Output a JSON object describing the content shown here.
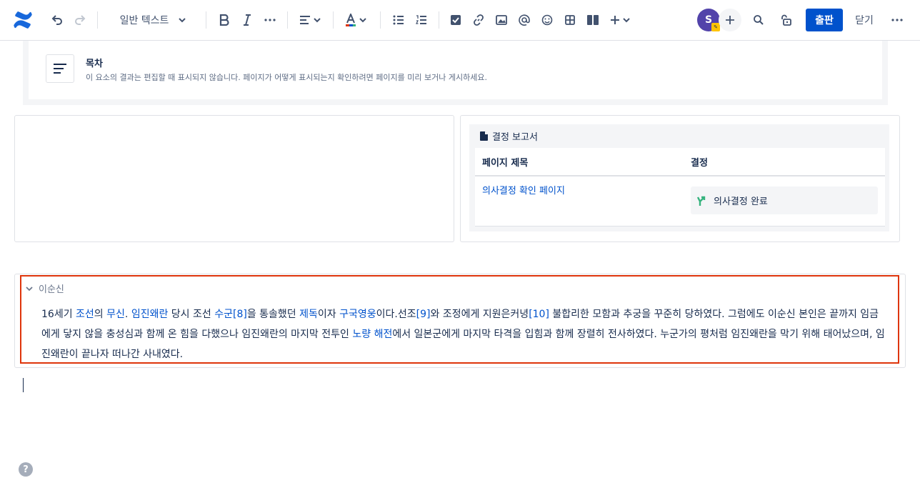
{
  "toolbar": {
    "text_style": "일반 텍스트",
    "avatar_initial": "S",
    "publish_label": "출판",
    "close_label": "닫기"
  },
  "toc": {
    "title": "목차",
    "description": "이 요소의 결과는 편집할 때 표시되지 않습니다. 페이지가 어떻게 표시되는지 확인하려면 페이지를 미리 보거나 게시하세요."
  },
  "decision_report": {
    "title": "결정 보고서",
    "col_page_title": "페이지 제목",
    "col_decision": "결정",
    "row_link": "의사결정 확인 페이지",
    "row_status": "의사결정 완료"
  },
  "expand": {
    "title": "이순신",
    "segments": [
      {
        "t": "16세기 "
      },
      {
        "t": "조선",
        "link": true
      },
      {
        "t": "의 "
      },
      {
        "t": "무신",
        "link": true
      },
      {
        "t": ". "
      },
      {
        "t": "임진왜란",
        "link": true
      },
      {
        "t": " 당시 조선 "
      },
      {
        "t": "수군",
        "link": true
      },
      {
        "t": "[8]",
        "link": true
      },
      {
        "t": "을 통솔했던 "
      },
      {
        "t": "제독",
        "link": true
      },
      {
        "t": "이자 "
      },
      {
        "t": "구국영웅",
        "link": true
      },
      {
        "t": "이다.선조"
      },
      {
        "t": "[9]",
        "link": true
      },
      {
        "t": "와 조정에게 지원은커녕"
      },
      {
        "t": "[10]",
        "link": true
      },
      {
        "t": " 불합리한 모함과 추궁을 꾸준히 당하였다. 그럼에도 이순신 본인은 끝까지 임금에게 닿지 않을 충성심과 함께 온 힘을 다했으나 임진왜란의 마지막 전투인 "
      },
      {
        "t": "노량 해전",
        "link": true
      },
      {
        "t": "에서 일본군에게 마지막 타격을 입힘과 함께 장렬히 전사하였다. 누군가의 평처럼 임진왜란을 막기 위해 태어났으며, 임진왜란이 끝나자 떠나간 사내였다."
      }
    ]
  },
  "colors": {
    "accent": "#0052cc",
    "selection": "#de350b",
    "avatar": "#5243aa",
    "decision_icon": "#36b37e"
  }
}
